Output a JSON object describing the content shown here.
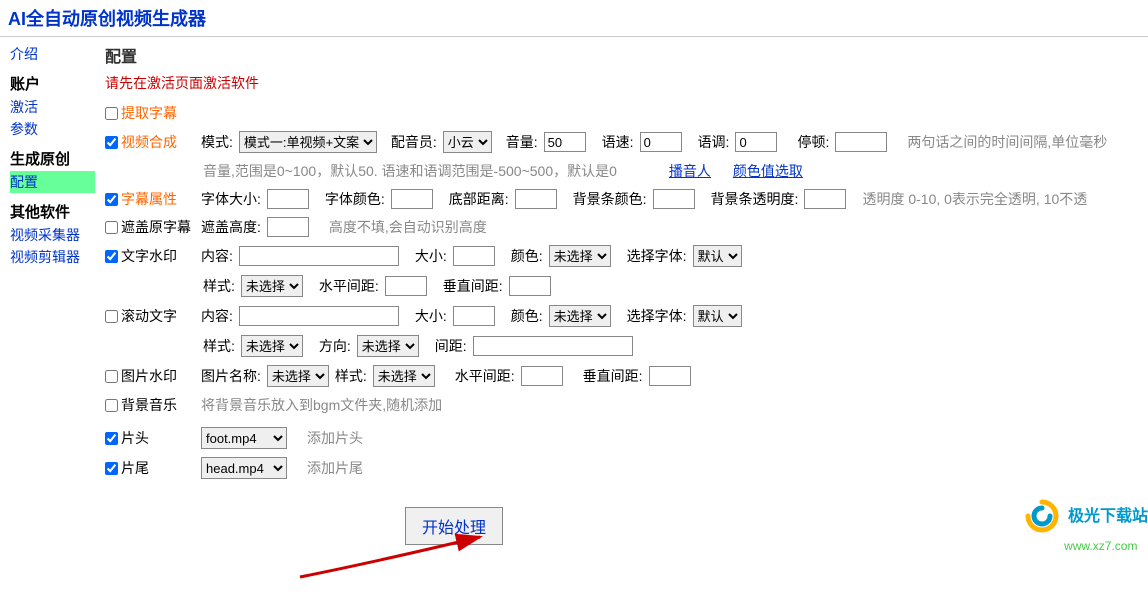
{
  "app_title": "AI全自动原创视频生成器",
  "sidebar": {
    "items": [
      {
        "label": "介绍",
        "type": "link"
      },
      {
        "label": "账户",
        "type": "section"
      },
      {
        "label": "激活",
        "type": "link"
      },
      {
        "label": "参数",
        "type": "link"
      },
      {
        "label": "生成原创",
        "type": "section"
      },
      {
        "label": "配置",
        "type": "link",
        "active": true
      },
      {
        "label": "其他软件",
        "type": "section"
      },
      {
        "label": "视频采集器",
        "type": "link"
      },
      {
        "label": "视频剪辑器",
        "type": "link"
      }
    ]
  },
  "main": {
    "title": "配置",
    "warning": "请先在激活页面激活软件",
    "extract_subtitle": {
      "label": "提取字幕",
      "checked": false
    },
    "video_compose": {
      "label": "视频合成",
      "checked": true,
      "mode_label": "模式:",
      "mode_value": "模式一:单视频+文案",
      "voice_actor_label": "配音员:",
      "voice_actor_value": "小云",
      "volume_label": "音量:",
      "volume_value": "50",
      "speed_label": "语速:",
      "speed_value": "0",
      "tone_label": "语调:",
      "tone_value": "0",
      "pause_label": "停顿:",
      "pause_value": "",
      "pause_hint": "两句话之间的时间间隔,单位毫秒",
      "range_hint": "音量,范围是0~100，默认50. 语速和语调范围是-500~500，默认是0",
      "link_broadcaster": "播音人",
      "link_color": "颜色值选取"
    },
    "subtitle_attr": {
      "label": "字幕属性",
      "checked": true,
      "font_size_label": "字体大小:",
      "font_size_value": "",
      "font_color_label": "字体颜色:",
      "font_color_value": "",
      "bottom_dist_label": "底部距离:",
      "bottom_dist_value": "",
      "bg_color_label": "背景条颜色:",
      "bg_color_value": "",
      "bg_opacity_label": "背景条透明度:",
      "bg_opacity_value": "",
      "opacity_hint": "透明度 0-10, 0表示完全透明, 10不透"
    },
    "cover_subtitle": {
      "label": "遮盖原字幕",
      "checked": false,
      "height_label": "遮盖高度:",
      "height_value": "",
      "height_hint": "高度不填,会自动识别高度"
    },
    "text_watermark": {
      "label": "文字水印",
      "checked": true,
      "content_label": "内容:",
      "content_value": "",
      "size_label": "大小:",
      "size_value": "",
      "color_label": "颜色:",
      "color_value": "未选择",
      "font_label": "选择字体:",
      "font_value": "默认",
      "style_label": "样式:",
      "style_value": "未选择",
      "hspace_label": "水平间距:",
      "hspace_value": "",
      "vspace_label": "垂直间距:",
      "vspace_value": ""
    },
    "scroll_text": {
      "label": "滚动文字",
      "checked": false,
      "content_label": "内容:",
      "content_value": "",
      "size_label": "大小:",
      "size_value": "",
      "color_label": "颜色:",
      "color_value": "未选择",
      "font_label": "选择字体:",
      "font_value": "默认",
      "style_label": "样式:",
      "style_value": "未选择",
      "dir_label": "方向:",
      "dir_value": "未选择",
      "space_label": "间距:",
      "space_value": ""
    },
    "image_watermark": {
      "label": "图片水印",
      "checked": false,
      "name_label": "图片名称:",
      "name_value": "未选择",
      "style_label": "样式:",
      "style_value": "未选择",
      "hspace_label": "水平间距:",
      "hspace_value": "",
      "vspace_label": "垂直间距:",
      "vspace_value": ""
    },
    "bgm": {
      "label": "背景音乐",
      "checked": false,
      "hint": "将背景音乐放入到bgm文件夹,随机添加"
    },
    "head": {
      "label": "片头",
      "checked": true,
      "value": "foot.mp4",
      "hint": "添加片头"
    },
    "tail": {
      "label": "片尾",
      "checked": true,
      "value": "head.mp4",
      "hint": "添加片尾"
    },
    "start_button": "开始处理"
  },
  "watermark": {
    "text": "极光下载站",
    "url": "www.xz7.com"
  }
}
